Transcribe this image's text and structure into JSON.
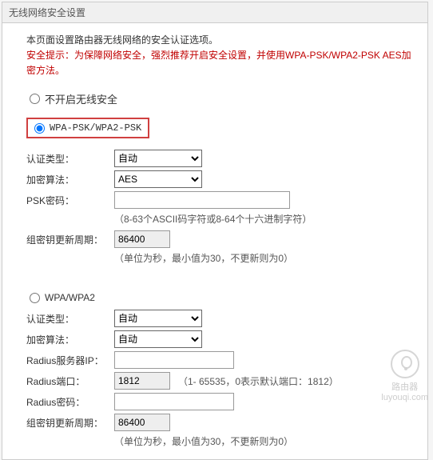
{
  "title": "无线网络安全设置",
  "intro": "本页面设置路由器无线网络的安全认证选项。",
  "warning": "安全提示：为保障网络安全，强烈推荐开启安全设置，并使用WPA-PSK/WPA2-PSK AES加密方法。",
  "radio_no_security": "不开启无线安全",
  "radio_wpapsk": "WPA-PSK/WPA2-PSK",
  "radio_wpa": "WPA/WPA2",
  "psk": {
    "auth_label": "认证类型：",
    "auth_value": "自动",
    "enc_label": "加密算法：",
    "enc_value": "AES",
    "psk_label": "PSK密码：",
    "psk_value": "",
    "psk_hint": "（8-63个ASCII码字符或8-64个十六进制字符）",
    "rekey_label": "组密钥更新周期：",
    "rekey_value": "86400",
    "rekey_hint": "（单位为秒，最小值为30，不更新则为0）"
  },
  "wpa": {
    "auth_label": "认证类型：",
    "auth_value": "自动",
    "enc_label": "加密算法：",
    "enc_value": "自动",
    "radius_ip_label": "Radius服务器IP：",
    "radius_ip_value": "",
    "radius_port_label": "Radius端口：",
    "radius_port_value": "1812",
    "radius_port_hint": "（1- 65535，0表示默认端口：1812）",
    "radius_pwd_label": "Radius密码：",
    "radius_pwd_value": "",
    "rekey_label": "组密钥更新周期：",
    "rekey_value": "86400",
    "rekey_hint": "（单位为秒，最小值为30，不更新则为0）"
  },
  "watermark": {
    "line1": "路由器",
    "line2": "luyouqi.com"
  }
}
